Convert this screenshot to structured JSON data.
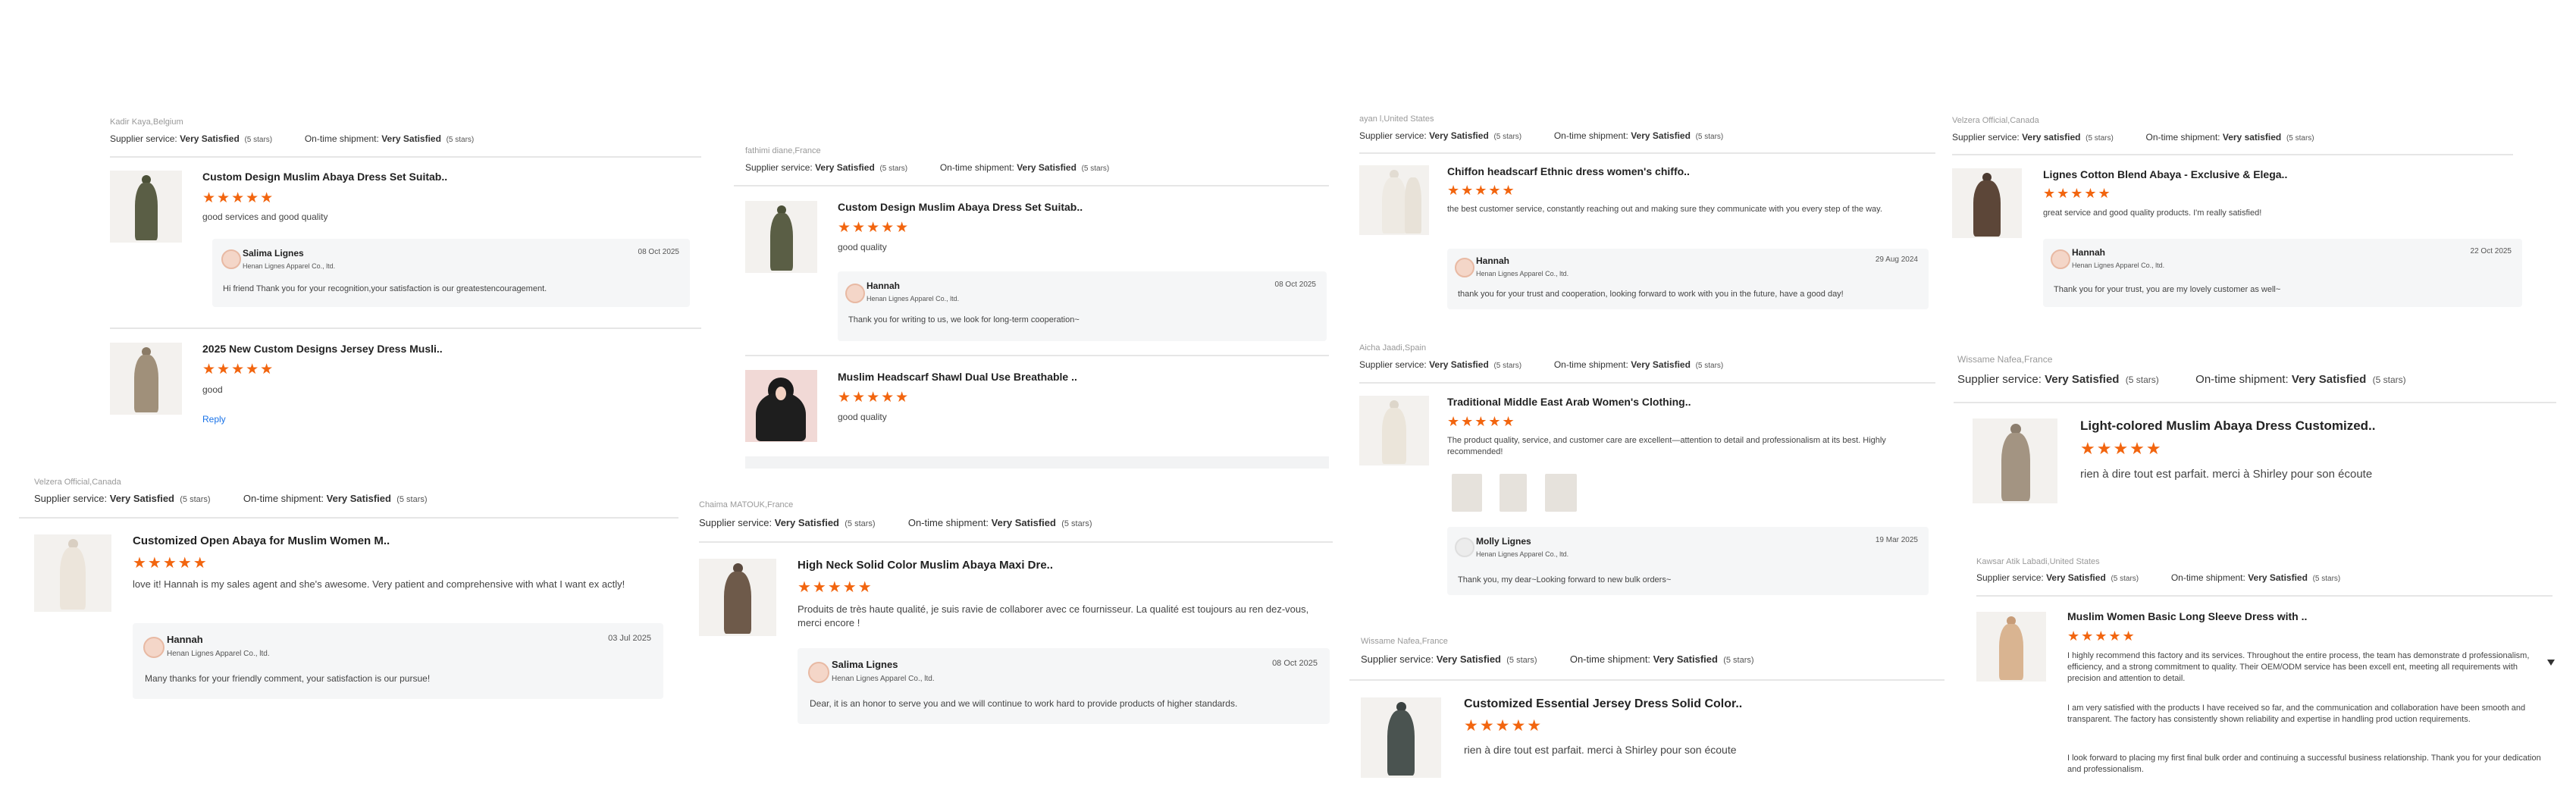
{
  "labels": {
    "supplier_service": "Supplier service:",
    "on_time_shipment": "On-time shipment:",
    "reply_link": "Reply"
  },
  "accent_color": "#f2650f",
  "reviews": [
    {
      "reviewer": "Kadir Kaya,Belgium",
      "supplier_service": "Very Satisfied",
      "supplier_stars": "(5 stars)",
      "shipment": "Very Satisfied",
      "shipment_stars": "(5 stars)",
      "items": [
        {
          "title": "Custom Design Muslim Abaya Dress Set Suitab..",
          "rating": "★★★★★",
          "comment": "good services and good quality",
          "reply": {
            "name": "Salima Lignes",
            "company": "Henan Lignes Apparel Co., ltd.",
            "date": "08 Oct 2025",
            "text": "Hi friend  Thank you for your recognition,your satisfaction is our greatestencouragement."
          }
        },
        {
          "title": "2025 New Custom Designs Jersey Dress Musli..",
          "rating": "★★★★★",
          "comment": "good",
          "reply_link": "Reply"
        }
      ]
    },
    {
      "reviewer": "Velzera Official,Canada",
      "supplier_service": "Very Satisfied",
      "supplier_stars": "(5 stars)",
      "shipment": "Very Satisfied",
      "shipment_stars": "(5 stars)",
      "items": [
        {
          "title": "Customized Open Abaya for Muslim Women M..",
          "rating": "★★★★★",
          "comment": "love it! Hannah is my sales agent and she's awesome. Very patient and comprehensive with what I want ex actly!",
          "reply": {
            "name": "Hannah",
            "company": "Henan Lignes Apparel Co., ltd.",
            "date": "03 Jul 2025",
            "text": "Many thanks for your friendly comment, your satisfaction is our pursue!"
          }
        }
      ]
    },
    {
      "reviewer": "fathimi diane,France",
      "supplier_service": "Very Satisfied",
      "supplier_stars": "(5 stars)",
      "shipment": "Very Satisfied",
      "shipment_stars": "(5 stars)",
      "items": [
        {
          "title": "Custom Design Muslim Abaya Dress Set Suitab..",
          "rating": "★★★★★",
          "comment": "good quality",
          "reply": {
            "name": "Hannah",
            "company": "Henan Lignes Apparel Co., ltd.",
            "date": "08 Oct 2025",
            "text": "Thank you for  writing to us, we look for long-term cooperation~"
          }
        },
        {
          "title": "Muslim Headscarf Shawl Dual Use Breathable ..",
          "rating": "★★★★★",
          "comment": "good quality"
        }
      ]
    },
    {
      "reviewer": "Chaima MATOUK,France",
      "supplier_service": "Very Satisfied",
      "supplier_stars": "(5 stars)",
      "shipment": "Very Satisfied",
      "shipment_stars": "(5 stars)",
      "items": [
        {
          "title": "High Neck Solid Color Muslim Abaya Maxi Dre..",
          "rating": "★★★★★",
          "comment": "Produits de très haute qualité, je suis ravie de collaborer avec ce fournisseur. La qualité est toujours au ren dez-vous, merci encore !",
          "reply": {
            "name": "Salima Lignes",
            "company": "Henan Lignes Apparel Co., ltd.",
            "date": "08 Oct 2025",
            "text": "Dear, it is an honor to serve you and we will continue to work hard to provide products of higher standards."
          }
        }
      ]
    },
    {
      "reviewer": "ayan l,United States",
      "supplier_service": "Very Satisfied",
      "supplier_stars": "(5 stars)",
      "shipment": "Very Satisfied",
      "shipment_stars": "(5 stars)",
      "items": [
        {
          "title": "Chiffon headscarf Ethnic dress women's chiffo..",
          "rating": "★★★★★",
          "comment": "the best customer service, constantly reaching out and making sure they communicate with you every step of the way.",
          "reply": {
            "name": "Hannah",
            "company": "Henan Lignes Apparel Co., ltd.",
            "date": "29 Aug 2024",
            "text": "thank you for your trust and cooperation, looking forward to work with you in the future, have a good day!"
          }
        }
      ]
    },
    {
      "reviewer": "Aicha Jaadi,Spain",
      "supplier_service": "Very Satisfied",
      "supplier_stars": "(5 stars)",
      "shipment": "Very Satisfied",
      "shipment_stars": "(5 stars)",
      "items": [
        {
          "title": "Traditional Middle East Arab Women's Clothing..",
          "rating": "★★★★★",
          "comment": "The product quality, service, and customer care are excellent—attention to detail and professionalism at its best. Highly recommended!",
          "reply": {
            "name": "Molly Lignes",
            "company": "Henan Lignes Apparel Co., ltd.",
            "date": "19 Mar 2025",
            "text": "Thank you,   my dear~Looking forward to new bulk orders~"
          }
        }
      ]
    },
    {
      "reviewer": "Wissame Nafea,France",
      "supplier_service": "Very Satisfied",
      "supplier_stars": "(5 stars)",
      "shipment": "Very Satisfied",
      "shipment_stars": "(5 stars)",
      "items": [
        {
          "title": "Customized Essential Jersey Dress Solid Color..",
          "rating": "★★★★★",
          "comment": "rien à dire tout est parfait. merci à Shirley pour son écoute"
        }
      ]
    },
    {
      "reviewer": "Velzera Official,Canada",
      "supplier_service": "Very satisfied",
      "supplier_stars": "(5 stars)",
      "shipment": "Very satisfied",
      "shipment_stars": "(5 stars)",
      "items": [
        {
          "title": "Lignes Cotton Blend Abaya - Exclusive & Elega..",
          "rating": "★★★★★",
          "comment": "great service and good quality products. I'm really satisfied!",
          "reply": {
            "name": "Hannah",
            "company": "Henan Lignes Apparel Co., ltd.",
            "date": "22 Oct 2025",
            "text": "Thank you for your trust, you are my lovely customer as well~"
          }
        }
      ]
    },
    {
      "reviewer": "Wissame Nafea,France",
      "supplier_service": "Very Satisfied",
      "supplier_stars": "(5 stars)",
      "shipment": "Very Satisfied",
      "shipment_stars": "(5 stars)",
      "items": [
        {
          "title": "Light-colored Muslim Abaya Dress Customized..",
          "rating": "★★★★★",
          "comment": "rien à dire tout est parfait. merci à Shirley pour son écoute"
        }
      ]
    },
    {
      "reviewer": "Kawsar Atik Labadi,United States",
      "supplier_service": "Very Satisfied",
      "supplier_stars": "(5 stars)",
      "shipment": "Very Satisfied",
      "shipment_stars": "(5 stars)",
      "items": [
        {
          "title": "Muslim Women Basic Long Sleeve Dress with ..",
          "rating": "★★★★★",
          "comment_paragraphs": [
            "I highly recommend this factory and its services. Throughout the entire process, the team has demonstrate d professionalism, efficiency, and a strong commitment to quality. Their OEM/ODM service has been excell ent, meeting all requirements with precision and attention to detail.",
            "I am very satisfied with the products I have received so far, and the communication and collaboration have been smooth and transparent. The factory has consistently shown reliability and expertise in handling prod uction requirements.",
            "I look forward to placing my first final bulk order and continuing a successful business relationship. Thank you for your dedication and professionalism."
          ]
        }
      ]
    }
  ]
}
